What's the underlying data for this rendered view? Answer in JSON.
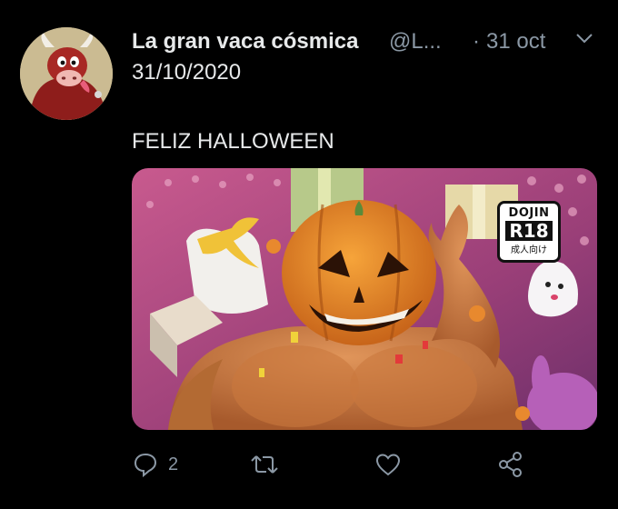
{
  "tweet": {
    "author": {
      "display_name": "La gran vaca cósmica",
      "handle": "@L...",
      "avatar_icon": "cow-avatar"
    },
    "separator": "·",
    "timestamp": "31 oct",
    "menu_icon": "chevron-down-icon",
    "text_lines": [
      "31/10/2020",
      "FELIZ HALLOWEEN"
    ],
    "media": {
      "subject_icon": "pumpkin-head-illustration",
      "badge": {
        "top": "DOJIN",
        "middle": "R18",
        "bottom": "成人向け"
      }
    },
    "actions": {
      "reply": {
        "icon": "reply-icon",
        "count": "2"
      },
      "retweet": {
        "icon": "retweet-icon"
      },
      "like": {
        "icon": "heart-icon"
      },
      "share": {
        "icon": "share-icon"
      }
    },
    "colors": {
      "background": "#000000",
      "text": "#e7e9ea",
      "muted": "#8b98a5"
    }
  }
}
